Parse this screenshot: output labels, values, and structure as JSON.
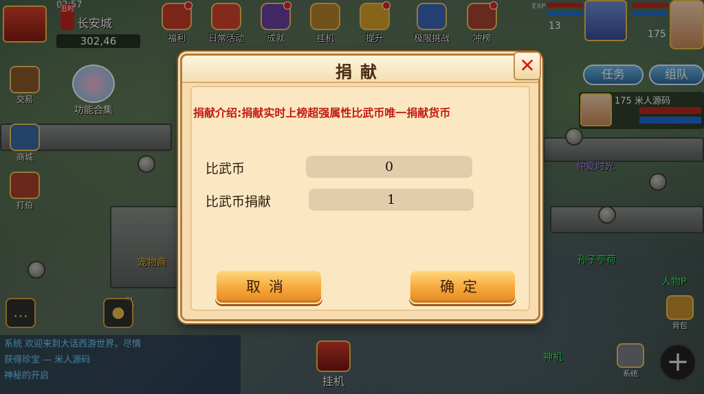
{
  "location": {
    "time": "02:57",
    "badge": "丑时",
    "name": "长安城",
    "coords": "302,46"
  },
  "top_icons": [
    {
      "label": "福利",
      "color": "#c73a2b"
    },
    {
      "label": "日常活动",
      "color": "#d6452f"
    },
    {
      "label": "成就",
      "color": "#6a3fa0"
    },
    {
      "label": "挂机",
      "color": "#b8852e"
    },
    {
      "label": "提升",
      "color": "#d8a32a"
    },
    {
      "label": "极限挑战",
      "color": "#3a66b8"
    },
    {
      "label": "冲榜",
      "color": "#a8442e"
    }
  ],
  "hud": {
    "exp_label": "EXP",
    "level_a": "13",
    "level_b": "175"
  },
  "right_buttons": {
    "task": "任务",
    "team": "组队"
  },
  "teammate": {
    "name": "175 米人源码"
  },
  "left_icons": [
    {
      "label": "交易",
      "color": "#8a5a2c"
    },
    {
      "label": "商城",
      "color": "#3a6aa8"
    },
    {
      "label": "打伯",
      "color": "#a8422e"
    }
  ],
  "func_all_label": "功能合集",
  "scene_labels": [
    {
      "text": "宠物商",
      "color": "#ffcc33"
    },
    {
      "text": "队",
      "color": "#ffffff"
    },
    {
      "text": "仲夏时光",
      "color": "#b98cff"
    },
    {
      "text": "孙子亭荷",
      "color": "#33ff66"
    },
    {
      "text": "人物P",
      "color": "#33ff66"
    },
    {
      "text": "神机",
      "color": "#33ff66"
    }
  ],
  "chat": {
    "lines": [
      "系统 欢迎来到大话西游世界，尽情",
      "获得珍宝 — 米人源码",
      "神秘的开启"
    ]
  },
  "bottom": {
    "hangup": "挂机",
    "bag": "背包",
    "system": "系统",
    "plus": "+"
  },
  "dialog": {
    "title": "捐献",
    "intro": "捐献介绍:捐献实时上榜超强属性比武币唯一捐献货币",
    "rows": [
      {
        "label": "比武币",
        "value": "0"
      },
      {
        "label": "比武币捐献",
        "value": "1"
      }
    ],
    "cancel": "取消",
    "confirm": "确定",
    "close_symbol": "✕"
  }
}
